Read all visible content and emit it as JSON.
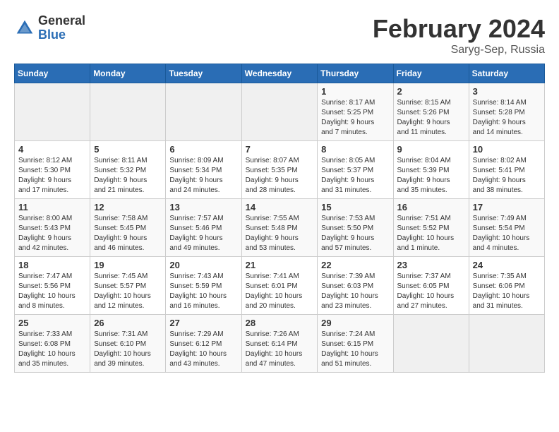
{
  "header": {
    "logo_general": "General",
    "logo_blue": "Blue",
    "month_year": "February 2024",
    "location": "Saryg-Sep, Russia"
  },
  "days_of_week": [
    "Sunday",
    "Monday",
    "Tuesday",
    "Wednesday",
    "Thursday",
    "Friday",
    "Saturday"
  ],
  "weeks": [
    [
      {
        "day": "",
        "info": ""
      },
      {
        "day": "",
        "info": ""
      },
      {
        "day": "",
        "info": ""
      },
      {
        "day": "",
        "info": ""
      },
      {
        "day": "1",
        "info": "Sunrise: 8:17 AM\nSunset: 5:25 PM\nDaylight: 9 hours\nand 7 minutes."
      },
      {
        "day": "2",
        "info": "Sunrise: 8:15 AM\nSunset: 5:26 PM\nDaylight: 9 hours\nand 11 minutes."
      },
      {
        "day": "3",
        "info": "Sunrise: 8:14 AM\nSunset: 5:28 PM\nDaylight: 9 hours\nand 14 minutes."
      }
    ],
    [
      {
        "day": "4",
        "info": "Sunrise: 8:12 AM\nSunset: 5:30 PM\nDaylight: 9 hours\nand 17 minutes."
      },
      {
        "day": "5",
        "info": "Sunrise: 8:11 AM\nSunset: 5:32 PM\nDaylight: 9 hours\nand 21 minutes."
      },
      {
        "day": "6",
        "info": "Sunrise: 8:09 AM\nSunset: 5:34 PM\nDaylight: 9 hours\nand 24 minutes."
      },
      {
        "day": "7",
        "info": "Sunrise: 8:07 AM\nSunset: 5:35 PM\nDaylight: 9 hours\nand 28 minutes."
      },
      {
        "day": "8",
        "info": "Sunrise: 8:05 AM\nSunset: 5:37 PM\nDaylight: 9 hours\nand 31 minutes."
      },
      {
        "day": "9",
        "info": "Sunrise: 8:04 AM\nSunset: 5:39 PM\nDaylight: 9 hours\nand 35 minutes."
      },
      {
        "day": "10",
        "info": "Sunrise: 8:02 AM\nSunset: 5:41 PM\nDaylight: 9 hours\nand 38 minutes."
      }
    ],
    [
      {
        "day": "11",
        "info": "Sunrise: 8:00 AM\nSunset: 5:43 PM\nDaylight: 9 hours\nand 42 minutes."
      },
      {
        "day": "12",
        "info": "Sunrise: 7:58 AM\nSunset: 5:45 PM\nDaylight: 9 hours\nand 46 minutes."
      },
      {
        "day": "13",
        "info": "Sunrise: 7:57 AM\nSunset: 5:46 PM\nDaylight: 9 hours\nand 49 minutes."
      },
      {
        "day": "14",
        "info": "Sunrise: 7:55 AM\nSunset: 5:48 PM\nDaylight: 9 hours\nand 53 minutes."
      },
      {
        "day": "15",
        "info": "Sunrise: 7:53 AM\nSunset: 5:50 PM\nDaylight: 9 hours\nand 57 minutes."
      },
      {
        "day": "16",
        "info": "Sunrise: 7:51 AM\nSunset: 5:52 PM\nDaylight: 10 hours\nand 1 minute."
      },
      {
        "day": "17",
        "info": "Sunrise: 7:49 AM\nSunset: 5:54 PM\nDaylight: 10 hours\nand 4 minutes."
      }
    ],
    [
      {
        "day": "18",
        "info": "Sunrise: 7:47 AM\nSunset: 5:56 PM\nDaylight: 10 hours\nand 8 minutes."
      },
      {
        "day": "19",
        "info": "Sunrise: 7:45 AM\nSunset: 5:57 PM\nDaylight: 10 hours\nand 12 minutes."
      },
      {
        "day": "20",
        "info": "Sunrise: 7:43 AM\nSunset: 5:59 PM\nDaylight: 10 hours\nand 16 minutes."
      },
      {
        "day": "21",
        "info": "Sunrise: 7:41 AM\nSunset: 6:01 PM\nDaylight: 10 hours\nand 20 minutes."
      },
      {
        "day": "22",
        "info": "Sunrise: 7:39 AM\nSunset: 6:03 PM\nDaylight: 10 hours\nand 23 minutes."
      },
      {
        "day": "23",
        "info": "Sunrise: 7:37 AM\nSunset: 6:05 PM\nDaylight: 10 hours\nand 27 minutes."
      },
      {
        "day": "24",
        "info": "Sunrise: 7:35 AM\nSunset: 6:06 PM\nDaylight: 10 hours\nand 31 minutes."
      }
    ],
    [
      {
        "day": "25",
        "info": "Sunrise: 7:33 AM\nSunset: 6:08 PM\nDaylight: 10 hours\nand 35 minutes."
      },
      {
        "day": "26",
        "info": "Sunrise: 7:31 AM\nSunset: 6:10 PM\nDaylight: 10 hours\nand 39 minutes."
      },
      {
        "day": "27",
        "info": "Sunrise: 7:29 AM\nSunset: 6:12 PM\nDaylight: 10 hours\nand 43 minutes."
      },
      {
        "day": "28",
        "info": "Sunrise: 7:26 AM\nSunset: 6:14 PM\nDaylight: 10 hours\nand 47 minutes."
      },
      {
        "day": "29",
        "info": "Sunrise: 7:24 AM\nSunset: 6:15 PM\nDaylight: 10 hours\nand 51 minutes."
      },
      {
        "day": "",
        "info": ""
      },
      {
        "day": "",
        "info": ""
      }
    ]
  ]
}
